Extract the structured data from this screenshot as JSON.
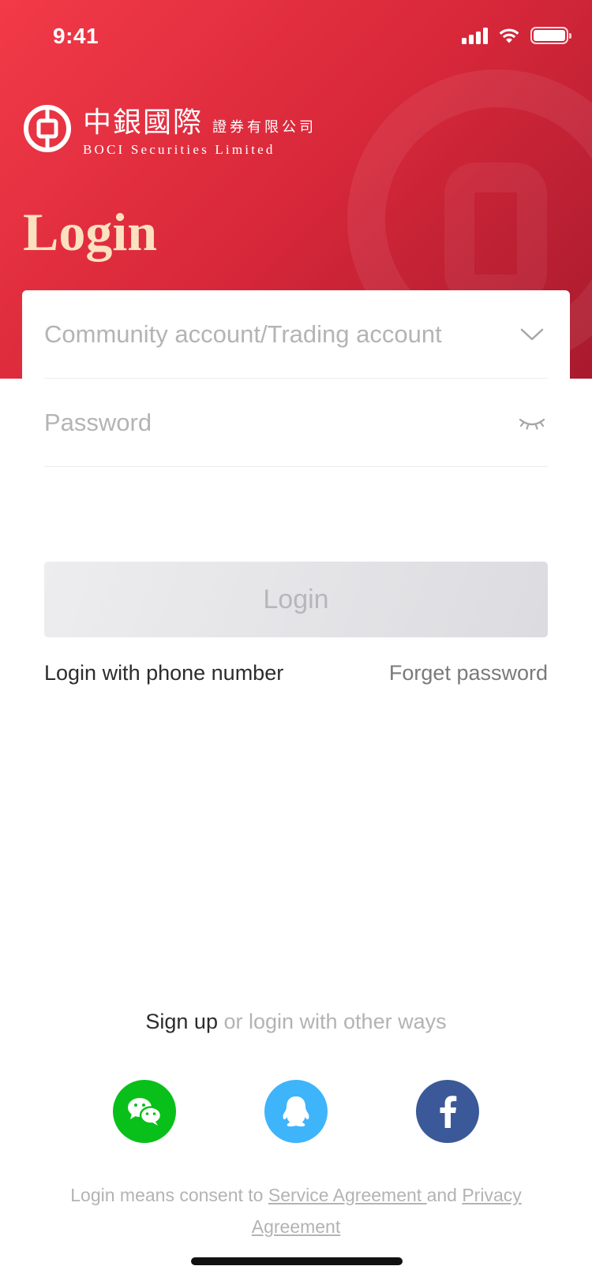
{
  "status_bar": {
    "time": "9:41"
  },
  "brand": {
    "name_cn": "中銀國際",
    "suffix_cn": "證券有限公司",
    "name_en": "BOCI Securities Limited"
  },
  "page": {
    "title": "Login"
  },
  "form": {
    "account_placeholder": "Community account/Trading account",
    "account_value": "",
    "password_placeholder": "Password",
    "password_value": "",
    "login_label": "Login"
  },
  "links": {
    "phone_login": "Login with phone number",
    "forget_password": "Forget password"
  },
  "alternate": {
    "signup": "Sign up",
    "other_ways": " or login with other ways",
    "providers": [
      {
        "name": "WeChat",
        "icon": "wechat-icon",
        "color": "#09c01a"
      },
      {
        "name": "QQ",
        "icon": "qq-icon",
        "color": "#3eb4fb"
      },
      {
        "name": "Facebook",
        "icon": "facebook-icon",
        "color": "#3b5999"
      }
    ]
  },
  "legal": {
    "prefix": "Login means consent to ",
    "service_agreement": "Service Agreement ",
    "and": "and ",
    "privacy_agreement": "Privacy Agreement"
  },
  "colors": {
    "brand_red": "#e3303f",
    "title_gold": "#fbe1c1"
  }
}
